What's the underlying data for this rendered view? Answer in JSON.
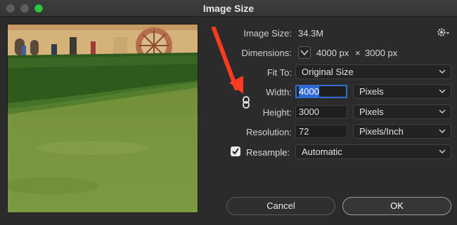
{
  "window": {
    "title": "Image Size"
  },
  "settings": {
    "image_size_label": "Image Size:",
    "image_size_value": "34.3M",
    "dimensions_label": "Dimensions:",
    "dim_width": "4000 px",
    "dim_sep": "×",
    "dim_height": "3000 px",
    "fit_to_label": "Fit To:",
    "fit_to_value": "Original Size",
    "width_label": "Width:",
    "width_value": "4000",
    "width_unit": "Pixels",
    "height_label": "Height:",
    "height_value": "3000",
    "height_unit": "Pixels",
    "resolution_label": "Resolution:",
    "resolution_value": "72",
    "resolution_unit": "Pixels/Inch",
    "resample_label": "Resample:",
    "resample_checked": true,
    "resample_value": "Automatic"
  },
  "buttons": {
    "cancel": "Cancel",
    "ok": "OK"
  },
  "colors": {
    "accent": "#2d6ad8",
    "annotation_arrow": "#ff3b1f",
    "maximize": "#2ec741"
  }
}
